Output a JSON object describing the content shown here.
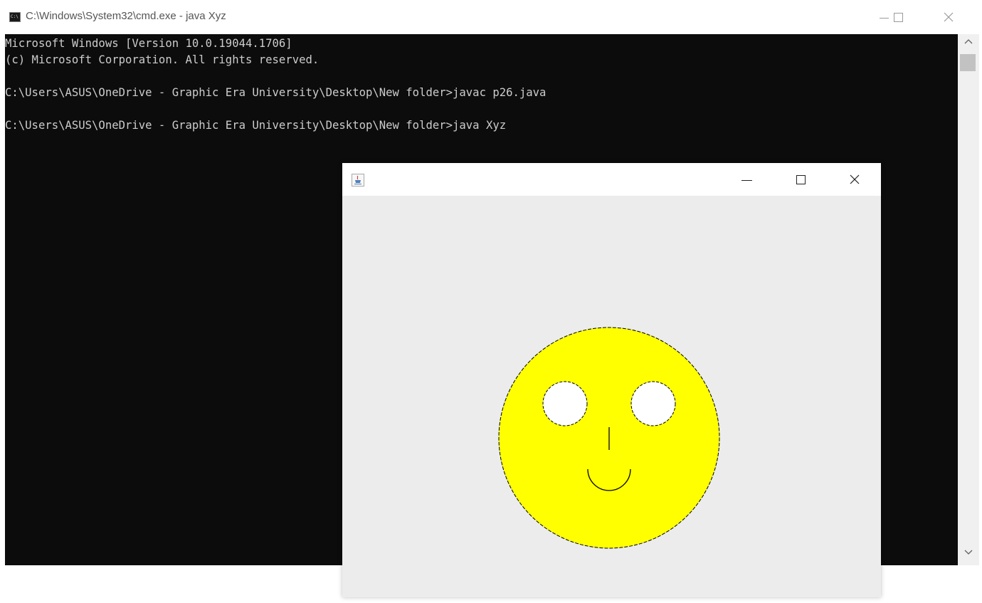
{
  "cmd_window": {
    "title": "C:\\Windows\\System32\\cmd.exe - java  Xyz",
    "icon": "cmd-icon",
    "icon_text": "C:\\",
    "console_lines": [
      "Microsoft Windows [Version 10.0.19044.1706]",
      "(c) Microsoft Corporation. All rights reserved.",
      "",
      "C:\\Users\\ASUS\\OneDrive - Graphic Era University\\Desktop\\New folder>javac p26.java",
      "",
      "C:\\Users\\ASUS\\OneDrive - Graphic Era University\\Desktop\\New folder>java Xyz"
    ],
    "colors": {
      "console_bg": "#0c0c0c",
      "console_text": "#cccccc"
    }
  },
  "java_window": {
    "icon": "java-coffee-icon",
    "canvas_bg": "#ececec",
    "face": {
      "fill": "#ffff00",
      "eye_fill": "#ffffff",
      "outline": "#000000"
    }
  }
}
